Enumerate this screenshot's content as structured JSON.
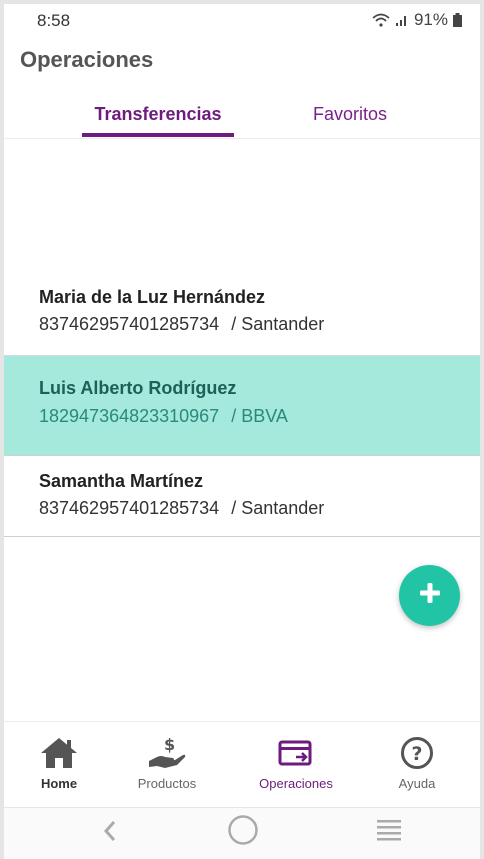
{
  "status": {
    "time": "8:58",
    "battery": "91%"
  },
  "header": {
    "title": "Operaciones"
  },
  "tabs": [
    {
      "label": "Transferencias",
      "active": true
    },
    {
      "label": "Favoritos",
      "active": false
    }
  ],
  "contacts": [
    {
      "name": "Maria de la Luz Hernández",
      "account": "837462957401285734",
      "bank": "/ Santander",
      "selected": false
    },
    {
      "name": "Luis Alberto Rodríguez",
      "account": "182947364823310967",
      "bank": "/ BBVA",
      "selected": true
    },
    {
      "name": "Samantha Martínez",
      "account": "837462957401285734",
      "bank": "/ Santander",
      "selected": false
    }
  ],
  "fab": {
    "icon": "plus-icon",
    "color": "#22c4a6"
  },
  "bottom_nav": {
    "items": [
      {
        "label": "Home",
        "icon": "home-icon"
      },
      {
        "label": "Productos",
        "icon": "money-hand-icon"
      },
      {
        "label": "Operaciones",
        "icon": "transfer-card-icon",
        "active": true
      },
      {
        "label": "Ayuda",
        "icon": "help-circle-icon"
      }
    ]
  },
  "colors": {
    "primary": "#6e1b7f",
    "accent": "#22c4a6",
    "selected_row": "#a5e8dc"
  }
}
